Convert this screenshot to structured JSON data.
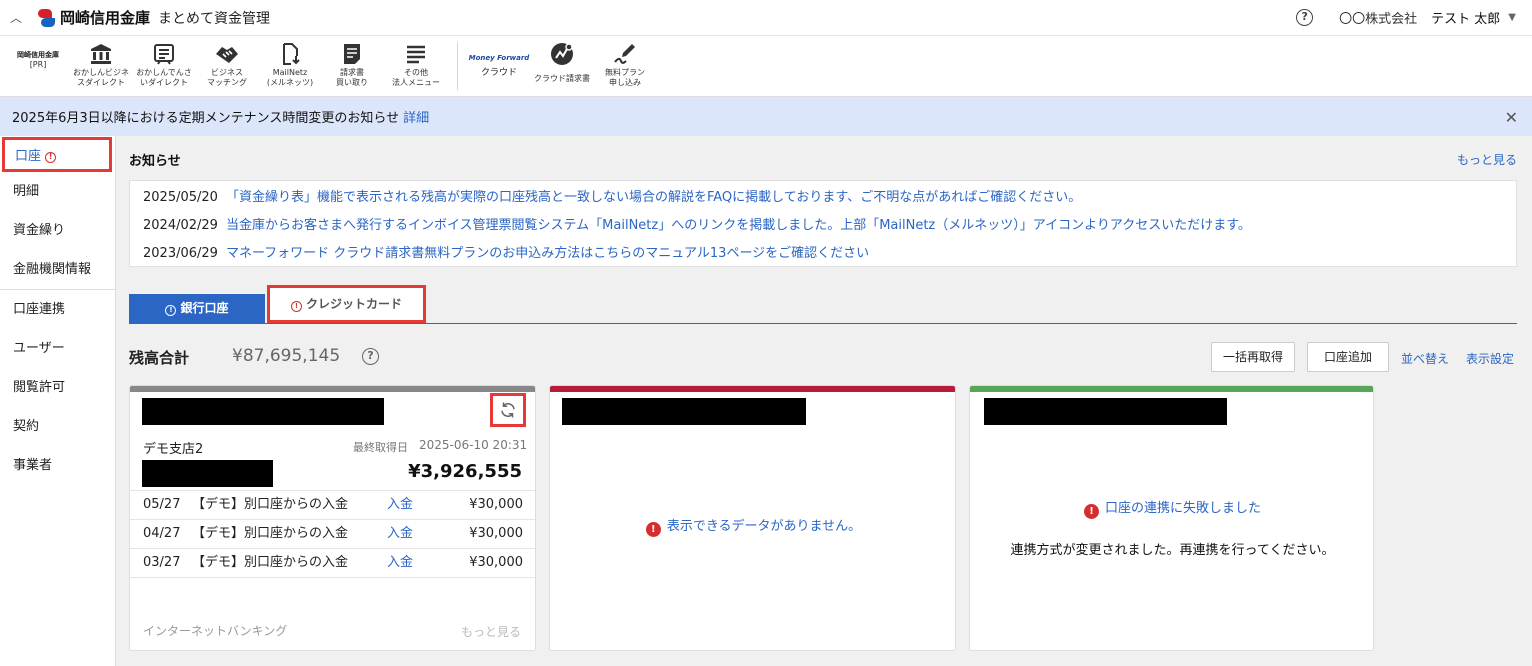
{
  "header": {
    "brand": "岡崎信用金庫",
    "app": "まとめて資金管理",
    "company": "〇〇株式会社",
    "user": "テスト 太郎"
  },
  "toolbar": {
    "pr_brand": "岡崎信用金庫",
    "pr_tag": "[PR]",
    "items": [
      {
        "label": "おかしんビジネ\nスダイレクト",
        "icon": "bank-icon"
      },
      {
        "label": "おかしんでんさ\nいダイレクト",
        "icon": "list-window-icon"
      },
      {
        "label": "ビジネス\nマッチング",
        "icon": "handshake-icon"
      },
      {
        "label": "MailNetz\n(メルネッツ)",
        "icon": "file-download-icon"
      },
      {
        "label": "請求書\n買い取り",
        "icon": "invoice-icon"
      },
      {
        "label": "その他\n法人メニュー",
        "icon": "menu-lines-icon"
      }
    ],
    "mf_logo": "Money Forward",
    "mf_sub": "クラウド",
    "cloud_invoice": "クラウド請求書",
    "free_plan": "無料プラン\n申し込み"
  },
  "banner": {
    "text": "2025年6月3日以降における定期メンテナンス時間変更のお知らせ",
    "link": "詳細"
  },
  "sidebar": {
    "items": [
      {
        "label": "口座"
      },
      {
        "label": "明細"
      },
      {
        "label": "資金繰り"
      },
      {
        "label": "金融機関情報"
      },
      {
        "label": "口座連携"
      },
      {
        "label": "ユーザー"
      },
      {
        "label": "閲覧許可"
      },
      {
        "label": "契約"
      },
      {
        "label": "事業者"
      }
    ]
  },
  "notices": {
    "title": "お知らせ",
    "more": "もっと見る",
    "items": [
      {
        "date": "2025/05/20",
        "text": "「資金繰り表」機能で表示される残高が実際の口座残高と一致しない場合の解説をFAQに掲載しております、ご不明な点があればご確認ください。"
      },
      {
        "date": "2024/02/29",
        "text": "当金庫からお客さまへ発行するインボイス管理票閲覧システム「MailNetz」へのリンクを掲載しました。上部「MailNetz（メルネッツ）」アイコンよりアクセスいただけます。"
      },
      {
        "date": "2023/06/29",
        "text": "マネーフォワード クラウド請求書無料プランのお申込み方法はこちらのマニュアル13ページをご確認ください"
      }
    ]
  },
  "tabs": {
    "bank": "銀行口座",
    "credit": "クレジットカード"
  },
  "balance": {
    "label": "残高合計",
    "value": "¥87,695,145"
  },
  "actions": {
    "refetch": "一括再取得",
    "add": "口座追加",
    "sort": "並べ替え",
    "display": "表示設定"
  },
  "cards": [
    {
      "branch": "デモ支店2",
      "last_label": "最終取得日",
      "last_time": "2025-06-10 20:31",
      "balance": "¥3,926,555",
      "transactions": [
        {
          "date": "05/27",
          "desc": "【デモ】別口座からの入金",
          "type": "入金",
          "amount": "¥30,000"
        },
        {
          "date": "04/27",
          "desc": "【デモ】別口座からの入金",
          "type": "入金",
          "amount": "¥30,000"
        },
        {
          "date": "03/27",
          "desc": "【デモ】別口座からの入金",
          "type": "入金",
          "amount": "¥30,000"
        }
      ],
      "footer": "インターネットバンキング",
      "more": "もっと見る"
    },
    {
      "message": "表示できるデータがありません。"
    },
    {
      "message": "口座の連携に失敗しました",
      "sub": "連携方式が変更されました。再連携を行ってください。"
    }
  ],
  "colors": {
    "accent": "#2b66c4",
    "banner": "#dce6fb",
    "highlight": "#e53935",
    "card1_bar": "#888888",
    "card2_bar": "#b71c3a",
    "card3_bar": "#57a557"
  }
}
